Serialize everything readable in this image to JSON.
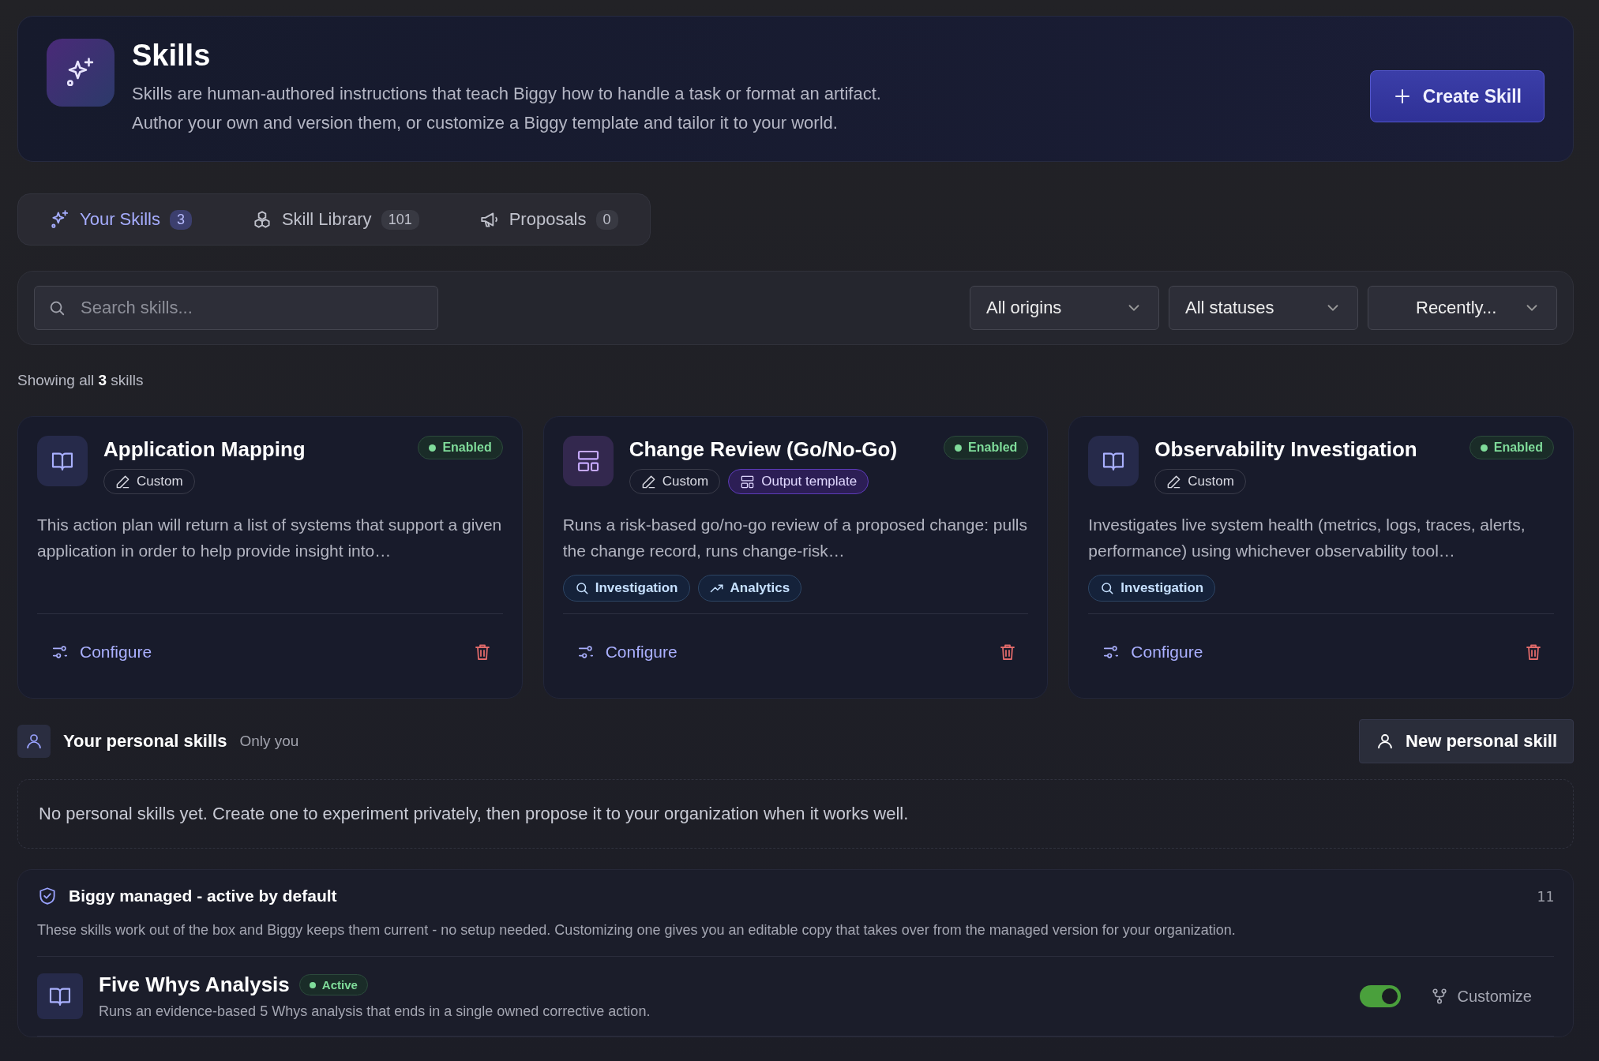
{
  "header": {
    "title": "Skills",
    "description": [
      "Skills are human-authored instructions that teach Biggy how to handle a task or format an artifact.",
      "Author your own and version them, or customize a Biggy template and tailor it to your world."
    ],
    "create_button": "Create Skill"
  },
  "tabs": [
    {
      "label": "Your Skills",
      "count": "3",
      "kind": "sparkles",
      "selected": true
    },
    {
      "label": "Skill Library",
      "count": "101",
      "kind": "cubes",
      "selected": false
    },
    {
      "label": "Proposals",
      "count": "0",
      "kind": "megaphone",
      "selected": false
    }
  ],
  "search": {
    "placeholder": "Search skills..."
  },
  "filters": [
    "All origins",
    "All statuses",
    "Recently..."
  ],
  "summary": "Showing all **3** skills",
  "cards": [
    {
      "title": "Application Mapping",
      "kind": "book",
      "status": "Enabled",
      "enabled": true,
      "tags": [
        {
          "label": "Custom",
          "kind": "custom"
        }
      ],
      "description": "This action plan will return a list of systems that support a given application in order to help provide insight into…",
      "action": "Configure"
    },
    {
      "title": "Change Review (Go/No-Go)",
      "kind": "layout",
      "status": "Enabled",
      "enabled": true,
      "tags": [
        {
          "label": "Custom",
          "kind": "custom"
        },
        {
          "label": "Output template",
          "kind": "template"
        }
      ],
      "description": "Runs a risk-based go/no-go review of a proposed change: pulls the change record, runs change-risk…",
      "categories": [
        {
          "label": "Investigation",
          "kind": "investigation"
        },
        {
          "label": "Analytics",
          "kind": "analytics"
        }
      ],
      "action": "Configure"
    },
    {
      "title": "Observability Investigation",
      "kind": "book",
      "status": "Enabled",
      "enabled": true,
      "tags": [
        {
          "label": "Custom",
          "kind": "custom"
        }
      ],
      "description": "Investigates live system health (metrics, logs, traces, alerts, performance) using whichever observability tool…",
      "categories": [
        {
          "label": "Investigation",
          "kind": "investigation"
        }
      ],
      "action": "Configure"
    }
  ],
  "personal": {
    "title": "Your personal skills",
    "subtitle": "Only you",
    "button": "New personal skill",
    "empty": "No personal skills yet. Create one to experiment privately, then propose it to your organization when it works well."
  },
  "managed": {
    "title": "Biggy managed - active by default",
    "count": "11",
    "description": "These skills work out of the box and Biggy keeps them current - no setup needed. Customizing one gives you an editable copy that takes over from the managed version for your organization.",
    "items": [
      {
        "title": "Five Whys Analysis",
        "status": "Active",
        "active": true,
        "description": "Runs an evidence-based 5 Whys analysis that ends in a single owned corrective action.",
        "on": true,
        "action": "Customize"
      }
    ]
  }
}
